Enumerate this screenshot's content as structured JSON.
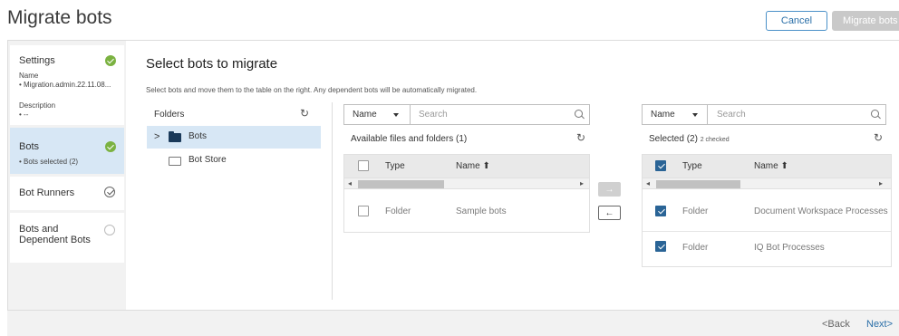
{
  "header": {
    "title": "Migrate bots",
    "cancel_label": "Cancel",
    "migrate_label": "Migrate bots"
  },
  "steps": [
    {
      "title": "Settings",
      "sub_label": "Name",
      "sub_value": "• Migration.admin.22.11.08...",
      "sub_label2": "Description",
      "sub_value2": "• --",
      "status": "complete"
    },
    {
      "title": "Bots",
      "sub_value": "• Bots selected (2)",
      "status": "complete",
      "active": true
    },
    {
      "title": "Bot Runners",
      "status": "checked-outline"
    },
    {
      "title": "Bots and Dependent Bots",
      "status": "incomplete"
    }
  ],
  "main": {
    "title": "Select bots to migrate",
    "description": "Select bots and move them to the table on the right. Any dependent bots will be automatically migrated."
  },
  "folders": {
    "label": "Folders",
    "items": [
      {
        "label": "Bots",
        "selected": true,
        "expand": ">"
      },
      {
        "label": "Bot Store",
        "selected": false
      }
    ]
  },
  "available": {
    "filter_field": "Name",
    "search_placeholder": "Search",
    "title": "Available files and folders (1)",
    "columns": [
      "Type",
      "Name ⬆"
    ],
    "rows": [
      {
        "type": "Folder",
        "name": "Sample bots",
        "checked": false
      }
    ]
  },
  "move": {
    "right": "→",
    "left": "←"
  },
  "selected": {
    "filter_field": "Name",
    "search_placeholder": "Search",
    "title": "Selected (2)",
    "checked_count": "2 checked",
    "columns": [
      "Type",
      "Name ⬆"
    ],
    "rows": [
      {
        "type": "Folder",
        "name": "Document Workspace Processes",
        "checked": true
      },
      {
        "type": "Folder",
        "name": "IQ Bot Processes",
        "checked": true
      }
    ]
  },
  "footer": {
    "back": "<Back",
    "next": "Next>"
  },
  "colors": {
    "accent": "#2a6496",
    "success": "#7bb241",
    "selected_row": "#d7e7f5"
  }
}
